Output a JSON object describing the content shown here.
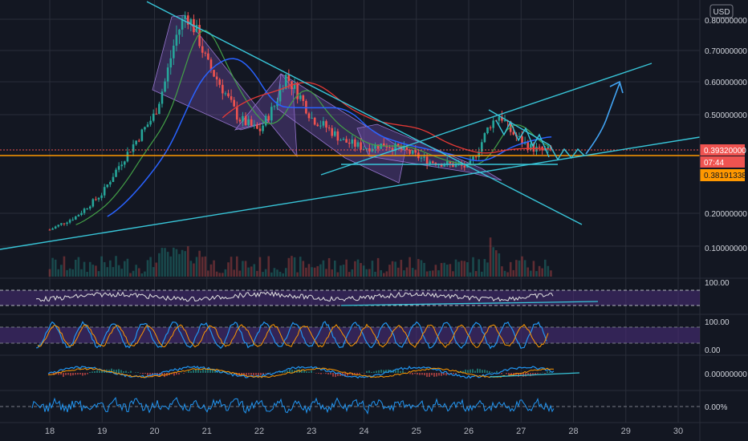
{
  "currency_label": "USD",
  "price_axis": [
    "0.80000000",
    "0.70000000",
    "0.60000000",
    "0.50000000",
    "0.20000000",
    "0.10000000"
  ],
  "price_badges": {
    "last": "0.39320000",
    "countdown": "07:44",
    "ma": "0.38191338"
  },
  "indicator_axes": {
    "rsi": "100.00",
    "stoch_top": "100.00",
    "stoch_bottom": "0.00",
    "macd": "0.00000000",
    "osc": "0.00%"
  },
  "x_axis": [
    "18",
    "19",
    "20",
    "21",
    "22",
    "23",
    "24",
    "25",
    "26",
    "27",
    "28",
    "29",
    "30"
  ],
  "colors": {
    "background": "#131722",
    "up": "#26a69a",
    "down": "#ef5350",
    "trendline": "#38c5d8",
    "pattern_fill": "#7e57c2",
    "ma_red": "#e53935",
    "ma_blue": "#2962ff",
    "ma_green": "#43a047",
    "arrow": "#42a5f5",
    "last_price": "#ef5350",
    "ma_price": "#ff9800",
    "band": "#4a2d7a"
  },
  "chart_data": {
    "type": "line",
    "title": "",
    "series": [
      {
        "x": [
          18,
          18.5,
          19,
          19.3,
          19.6,
          20,
          20.2,
          20.4,
          20.6,
          20.8,
          21,
          21.3,
          21.6,
          22,
          22.3,
          22.5,
          22.8,
          23,
          23.3,
          23.6,
          24,
          24.4,
          24.8,
          25.2,
          25.6,
          26,
          26.2,
          26.4,
          26.6,
          26.8,
          27,
          27.2,
          27.4,
          27.6
        ],
        "values": [
          0.15,
          0.19,
          0.26,
          0.34,
          0.41,
          0.5,
          0.6,
          0.74,
          0.82,
          0.76,
          0.66,
          0.58,
          0.49,
          0.45,
          0.53,
          0.62,
          0.55,
          0.49,
          0.46,
          0.42,
          0.4,
          0.41,
          0.39,
          0.36,
          0.35,
          0.34,
          0.4,
          0.47,
          0.5,
          0.45,
          0.42,
          0.4,
          0.39,
          0.393
        ]
      }
    ],
    "ylim": [
      0.05,
      0.85
    ],
    "xlim": [
      17.7,
      30.5
    ],
    "grid": true
  }
}
